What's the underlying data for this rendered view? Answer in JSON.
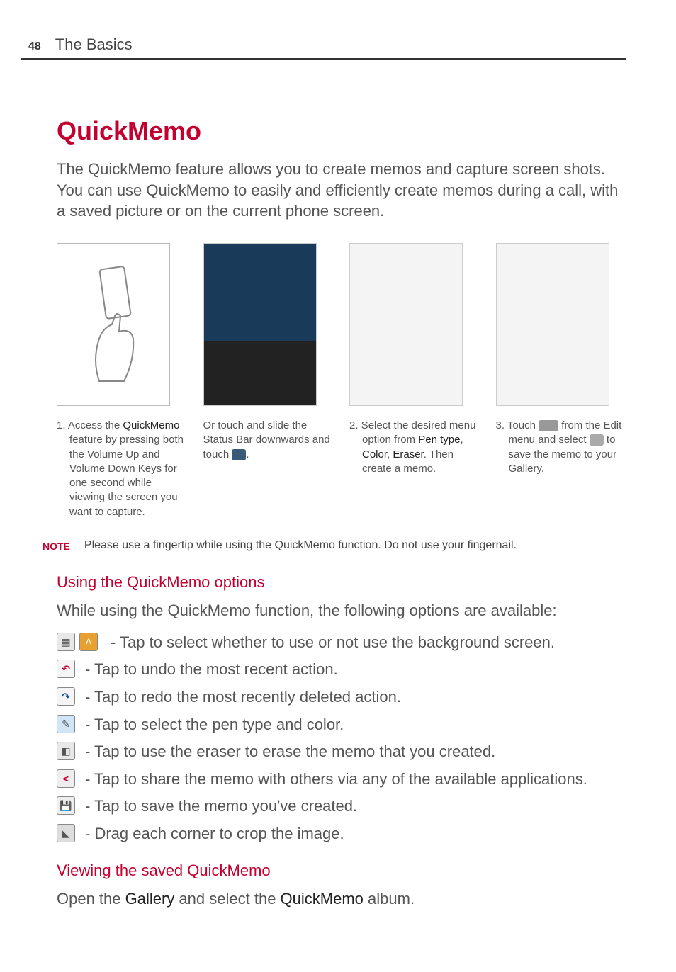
{
  "header": {
    "page_number": "48",
    "title": "The Basics"
  },
  "section": {
    "title": "QuickMemo",
    "intro": "The QuickMemo feature allows you to create memos and capture screen shots. You can use QuickMemo to easily and efficiently create memos during a call, with a saved picture or on the current phone screen."
  },
  "steps": {
    "col1": {
      "num": "1.",
      "text_before_strong": " Access the ",
      "strong": "QuickMemo",
      "text_after_strong": " feature by pressing both the Volume Up and Volume Down Keys for one second while viewing the screen you want to capture."
    },
    "col2": {
      "text": "Or touch and slide the Status Bar downwards and touch ",
      "suffix": "."
    },
    "col3": {
      "num": "2.",
      "text_a": " Select the desired menu option from ",
      "strong_a": "Pen type",
      "sep1": ", ",
      "strong_b": "Color",
      "sep2": ", ",
      "strong_c": "Eraser",
      "text_b": ". Then create a memo."
    },
    "col4": {
      "num": "3.",
      "text_a": " Touch ",
      "text_b": " from the Edit menu and select ",
      "text_c": " to save the memo to your Gallery."
    }
  },
  "note": {
    "label": "NOTE",
    "text": "Please use a fingertip while using the QuickMemo function. Do not use your fingernail."
  },
  "options": {
    "heading": "Using the QuickMemo options",
    "intro": "While using the QuickMemo function, the following options are available:",
    "items": {
      "bg": "- Tap to select whether to use or not use the background screen.",
      "undo": "- Tap to undo the most recent action.",
      "redo": "- Tap to redo the most recently deleted action.",
      "pen": "- Tap to select the pen type and color.",
      "eraser": "- Tap to use the eraser to erase the memo that you created.",
      "share": "- Tap to share the memo with others via any of the available applications.",
      "save": "- Tap to save the memo you've created.",
      "crop": "- Drag each corner to crop the image."
    }
  },
  "viewing": {
    "heading": "Viewing the saved QuickMemo",
    "text_a": "Open the ",
    "strong_a": "Gallery",
    "text_b": " and select the ",
    "strong_b": "QuickMemo",
    "text_c": " album."
  },
  "icon_glyphs": {
    "bg1": "▦",
    "bg2": "A",
    "undo": "↶",
    "redo": "↷",
    "pen": "✎",
    "eraser": "◧",
    "share": "<",
    "save": "💾",
    "crop": "◣"
  }
}
